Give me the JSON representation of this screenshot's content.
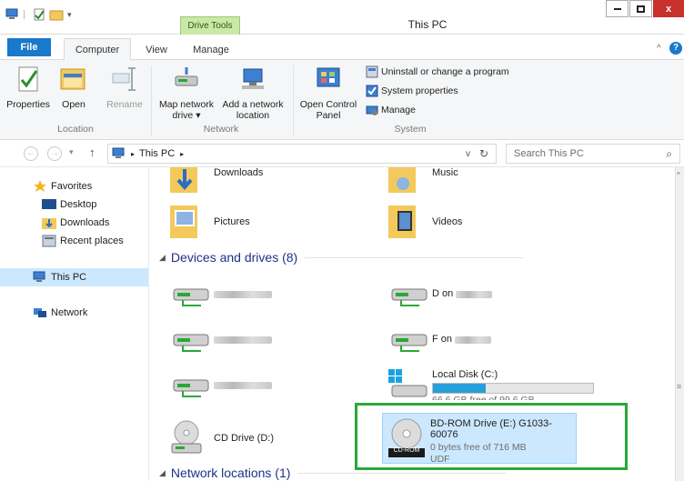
{
  "window": {
    "title": "This PC",
    "context_tab": "Drive Tools",
    "controls": [
      "–",
      "□",
      "x"
    ]
  },
  "tabs": [
    {
      "label": "File"
    },
    {
      "label": "Computer"
    },
    {
      "label": "View"
    },
    {
      "label": "Manage"
    }
  ],
  "ribbon": {
    "location": {
      "group": "Location",
      "buttons": [
        "Properties",
        "Open",
        "Rename"
      ]
    },
    "network": {
      "group": "Network",
      "map_drive": "Map network",
      "map_drive2": "drive ▾",
      "add_location": "Add a network",
      "add_location2": "location"
    },
    "system": {
      "group": "System",
      "open_cp": "Open Control",
      "open_cp2": "Panel",
      "uninstall": "Uninstall or change a program",
      "sys_props": "System properties",
      "manage": "Manage"
    }
  },
  "address": {
    "path_sep1": "▸",
    "path": "This PC",
    "path_sep2": "▸",
    "dropdown": "v",
    "refresh": "↻",
    "search_placeholder": "Search This PC",
    "search_icon": "⌕"
  },
  "nav": {
    "favorites": "Favorites",
    "desktop": "Desktop",
    "downloads": "Downloads",
    "recent": "Recent places",
    "thispc": "This PC",
    "network": "Network"
  },
  "folders": [
    {
      "name": "Downloads"
    },
    {
      "name": "Music"
    },
    {
      "name": "Pictures"
    },
    {
      "name": "Videos"
    }
  ],
  "devices_header": "Devices and drives (8)",
  "drives": {
    "d_label": "D on",
    "f_label": "F on",
    "c_name": "Local Disk (C:)",
    "c_sub": "66.6 GB free of 99.6 GB",
    "c_fill": 0.33,
    "cd_name": "CD Drive (D:)",
    "bd_name": "BD-ROM Drive (E:) G1033-60076",
    "bd_sub": "0 bytes free of 716 MB",
    "bd_fs": "UDF",
    "bd_badge": "CD-ROM"
  },
  "network_header": "Network locations (1)",
  "colors": {
    "accent": "#1979ca",
    "highlight_box": "#2aa837",
    "selected": "#cce8ff",
    "drive_tools": "#c9e9a9"
  }
}
